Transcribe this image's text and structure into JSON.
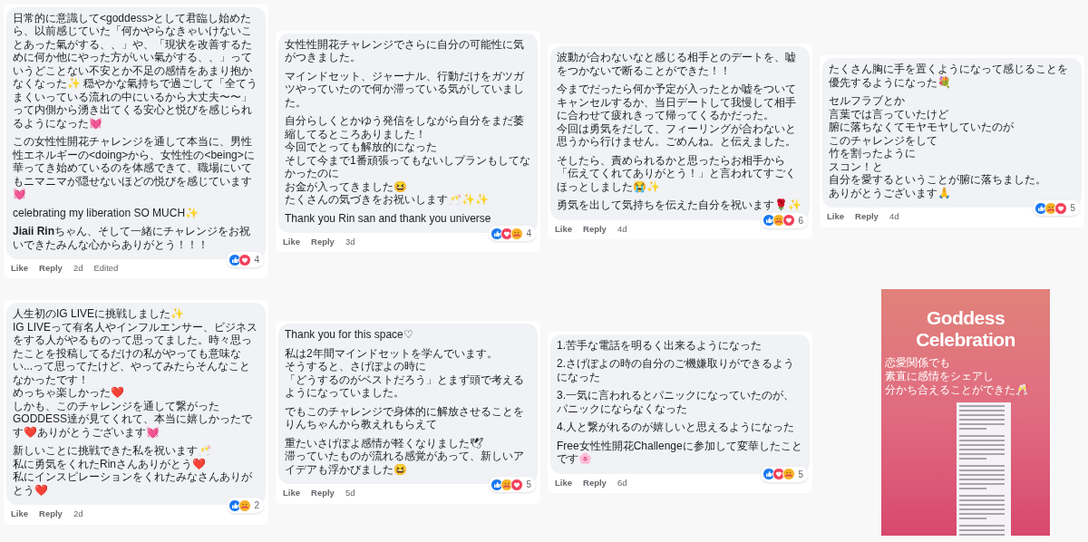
{
  "comments": [
    {
      "paragraphs": [
        [
          "日常的に意識して<goddess>として君臨し始めたら、以前感じていた「何かやらなきゃいけないことあった氣がする、、」や、「現状を改善するために何か他にやった方がいい氣がする、、」っていうどことない不安とか不足の感情をあまり抱かなくなった✨ 穏やかな氣持ちで過ごして「全てうまくいっている流れの中にいるから大丈夫〜〜」って内側から湧き出てくる安心と悦びを感じられるようになった💓"
        ],
        [
          "この女性性開花チャレンジを通して本当に、男性性エネルギーの<doing>から、女性性の<being>に華ってき始めているのを体感できて、職場にいてもニマニマが隠せないほどの悦びを感じています💓"
        ],
        [
          "celebrating my liberation SO MUCH✨"
        ],
        [
          "**Jiaii Rin**ちゃん、そして一緒にチャレンジをお祝いできたみんな心からありがとう！！！"
        ]
      ],
      "reactions": [
        {
          "kind": "like"
        },
        {
          "kind": "love"
        }
      ],
      "reaction_count": "4",
      "actions": [
        "Like",
        "Reply"
      ],
      "time": "2d",
      "edited": "Edited"
    },
    {
      "paragraphs": [
        [
          "女性性開花チャレンジでさらに自分の可能性に気がつきました。"
        ],
        [
          "マインドセット、ジャーナル、行動だけをガツガツやっていたので何か滞っている気がしていました。"
        ],
        [
          "自分らしくとかゆう発信をしながら自分をまだ萎縮してるところありました！",
          "今回でとっても解放的になった",
          "そして今まで1番頑張ってもないしプランもしてなかったのに",
          "お金が入ってきました😆",
          "たくさんの気づきをお祝いします🥂✨✨"
        ],
        [
          "Thank you Rin san and thank you universe"
        ]
      ],
      "reactions": [
        {
          "kind": "like"
        },
        {
          "kind": "love"
        },
        {
          "kind": "care"
        }
      ],
      "reaction_count": "4",
      "actions": [
        "Like",
        "Reply"
      ],
      "time": "3d"
    },
    {
      "paragraphs": [
        [
          "波動が合わないなと感じる相手とのデートを、嘘をつかないで断ることができた！！"
        ],
        [
          "今までだったら何か予定が入ったとか嘘をついてキャンセルするか、当日デートして我慢して相手に合わせて疲れきって帰ってくるかだった。",
          "今回は勇気をだして、フィーリングが合わないと思うから行けません。ごめんね。と伝えました。"
        ],
        [
          "そしたら、責められるかと思ったらお相手から「伝えてくれてありがとう！」と言われてすごくほっとしました😭✨"
        ],
        [
          "勇気を出して気持ちを伝えた自分を祝います🌹✨"
        ]
      ],
      "reactions": [
        {
          "kind": "like"
        },
        {
          "kind": "care"
        },
        {
          "kind": "love"
        }
      ],
      "reaction_count": "6",
      "actions": [
        "Like",
        "Reply"
      ],
      "time": "4d"
    },
    {
      "paragraphs": [
        [
          "たくさん胸に手を置くようになって感じることを優先するようになった💐"
        ],
        [
          "セルフラブとか",
          "言葉では言っていたけど",
          "腑に落ちなくてモヤモヤしていたのが",
          "このチャレンジをして",
          "竹を割ったように",
          "スコン！と",
          "自分を愛するということが腑に落ちました。",
          "ありがとうございます🙏"
        ]
      ],
      "reactions": [
        {
          "kind": "like"
        },
        {
          "kind": "care"
        },
        {
          "kind": "love"
        }
      ],
      "reaction_count": "5",
      "actions": [
        "Like",
        "Reply"
      ],
      "time": "4d"
    },
    {
      "paragraphs": [
        [
          "人生初のIG LIVEに挑戦しました✨",
          "IG LIVEって有名人やインフルエンサー、ビジネスをする人がやるものって思ってました。時々思ったことを投稿してるだけの私がやっても意味ない...って思ってたけど、やってみたらそんなことなかったです！",
          "めっちゃ楽しかった❤️",
          "しかも、このチャレンジを通して繋がったGODDESS達が見てくれて、本当に嬉しかったです❤️ありがとうございます💓"
        ],
        [
          "新しいことに挑戦できた私を祝います🥂",
          "私に勇気をくれたRinさんありがとう❤️",
          "私にインスピレーションをくれたみなさんありがとう❤️"
        ]
      ],
      "reactions": [
        {
          "kind": "like"
        },
        {
          "kind": "care"
        }
      ],
      "reaction_count": "2",
      "actions": [
        "Like",
        "Reply"
      ],
      "time": "2d"
    },
    {
      "paragraphs": [
        [
          "Thank you for this space♡"
        ],
        [
          "私は2年間マインドセットを学んでいます。",
          "そうすると、さげぽよの時に",
          "「どうするのがベストだろう」とまず頭で考えるようになっていました。"
        ],
        [
          "でもこのチャレンジで身体的に解放させることをりんちゃんから教えれもらえて"
        ],
        [
          "重たいさげぽよ感情が軽くなりました🕊",
          "滞っていたものが流れる感覚があって、新しいアイデアも浮かびました😆"
        ]
      ],
      "reactions": [
        {
          "kind": "like"
        },
        {
          "kind": "care"
        },
        {
          "kind": "love"
        }
      ],
      "reaction_count": "5",
      "actions": [
        "Like",
        "Reply"
      ],
      "time": "5d"
    },
    {
      "paragraphs": [
        [
          "1.苦手な電話を明るく出来るようになった"
        ],
        [
          "2.さげぽよの時の自分のご機嫌取りができるようになった"
        ],
        [
          "3.一気に言われるとパニックになっていたのが、パニックにならなくなった"
        ],
        [
          "4.人と繋がれるのが嬉しいと思えるようになった"
        ],
        [
          "Free女性性開花Challengeに参加して変華したことです🌸"
        ]
      ],
      "reactions": [
        {
          "kind": "like"
        },
        {
          "kind": "love"
        },
        {
          "kind": "care"
        }
      ],
      "reaction_count": "5",
      "actions": [
        "Like",
        "Reply"
      ],
      "time": "6d"
    }
  ],
  "poster": {
    "title": "Goddess Celebration",
    "caption": [
      "恋愛関係でも",
      "素直に感情をシェアし",
      "分かち合えることができた🥂"
    ]
  }
}
